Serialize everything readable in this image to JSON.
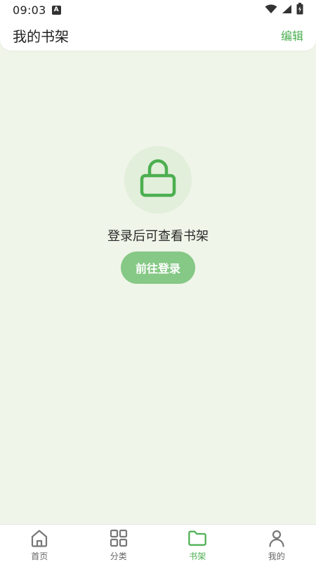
{
  "status_bar": {
    "time": "09:03",
    "notification_icon": "a-letter-icon",
    "icons": [
      "wifi-icon",
      "signal-icon",
      "battery-icon"
    ]
  },
  "header": {
    "title": "我的书架",
    "edit_label": "编辑"
  },
  "empty_state": {
    "icon": "lock-icon",
    "message": "登录后可查看书架",
    "button_label": "前往登录"
  },
  "bottom_nav": {
    "items": [
      {
        "label": "首页",
        "icon": "home-icon",
        "active": false
      },
      {
        "label": "分类",
        "icon": "grid-icon",
        "active": false
      },
      {
        "label": "书架",
        "icon": "folder-icon",
        "active": true
      },
      {
        "label": "我的",
        "icon": "person-icon",
        "active": false
      }
    ]
  },
  "colors": {
    "accent": "#4caf50",
    "button_bg": "#86c886",
    "page_bg": "#eff5e8",
    "icon_circle_bg": "#e2efdb",
    "inactive_icon": "#777777"
  }
}
